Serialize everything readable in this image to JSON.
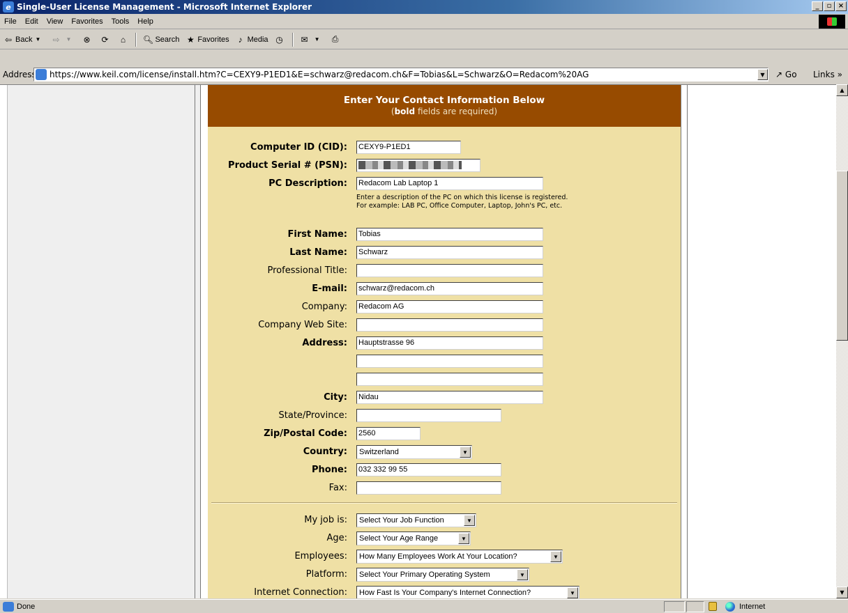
{
  "window": {
    "title": "Single-User License Management - Microsoft Internet Explorer",
    "min": "_",
    "max": "▫",
    "close": "×"
  },
  "menu": [
    "File",
    "Edit",
    "View",
    "Favorites",
    "Tools",
    "Help"
  ],
  "toolbar": {
    "back": "Back",
    "search": "Search",
    "favorites": "Favorites",
    "media": "Media"
  },
  "address": {
    "label": "Address",
    "url": "https://www.keil.com/license/install.htm?C=CEXY9-P1ED1&E=schwarz@redacom.ch&F=Tobias&L=Schwarz&O=Redacom%20AG",
    "go": "Go",
    "links": "Links »"
  },
  "form": {
    "title": "Enter Your Contact Information Below",
    "subtitle_pre": "(",
    "subtitle_bold": "bold",
    "subtitle_post": " fields are required)",
    "fields": {
      "cid": {
        "label": "Computer ID (CID):",
        "value": "CEXY9-P1ED1"
      },
      "psn": {
        "label": "Product Serial # (PSN):"
      },
      "pcdesc": {
        "label": "PC Description:",
        "value": "Redacom Lab Laptop 1"
      },
      "hint1": "Enter a description of the PC on which this license is registered.",
      "hint2": "For example: LAB PC, Office Computer, Laptop, John's PC, etc.",
      "first": {
        "label": "First Name:",
        "value": "Tobias"
      },
      "last": {
        "label": "Last Name:",
        "value": "Schwarz"
      },
      "title": {
        "label": "Professional Title:",
        "value": ""
      },
      "email": {
        "label": "E-mail:",
        "value": "schwarz@redacom.ch"
      },
      "company": {
        "label": "Company:",
        "value": "Redacom AG"
      },
      "website": {
        "label": "Company Web Site:",
        "value": ""
      },
      "address": {
        "label": "Address:",
        "value": "Hauptstrasse 96",
        "value2": "",
        "value3": ""
      },
      "city": {
        "label": "City:",
        "value": "Nidau"
      },
      "state": {
        "label": "State/Province:",
        "value": ""
      },
      "zip": {
        "label": "Zip/Postal Code:",
        "value": "2560"
      },
      "country": {
        "label": "Country:",
        "value": "Switzerland"
      },
      "phone": {
        "label": "Phone:",
        "value": "032 332 99 55"
      },
      "fax": {
        "label": "Fax:",
        "value": ""
      }
    },
    "survey": {
      "job": {
        "label": "My job is:",
        "value": "Select Your Job Function"
      },
      "age": {
        "label": "Age:",
        "value": "Select Your Age Range"
      },
      "employees": {
        "label": "Employees:",
        "value": "How Many Employees Work At Your Location?"
      },
      "platform": {
        "label": "Platform:",
        "value": "Select Your Primary Operating System"
      },
      "internet": {
        "label": "Internet Connection:",
        "value": "How Fast Is Your Company's Internet Connection?"
      }
    }
  },
  "status": {
    "text": "Done",
    "zone": "Internet"
  }
}
